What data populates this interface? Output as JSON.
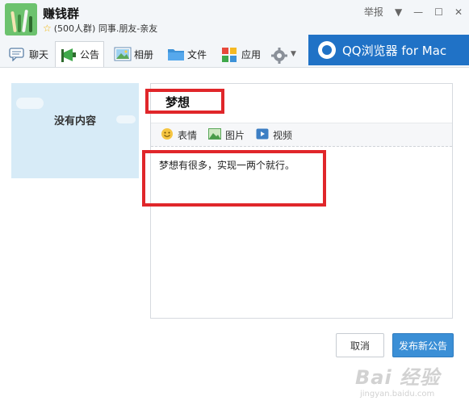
{
  "header": {
    "group_name": "赚钱群",
    "group_sub": "(500人群) 同事.朋友-亲友",
    "report_label": "举报"
  },
  "toolbar": {
    "tabs": [
      {
        "label": "聊天",
        "icon": "chat-icon"
      },
      {
        "label": "公告",
        "icon": "megaphone-icon",
        "active": true
      },
      {
        "label": "相册",
        "icon": "photo-icon"
      },
      {
        "label": "文件",
        "icon": "folder-icon"
      },
      {
        "label": "应用",
        "icon": "apps-icon"
      },
      {
        "label": "",
        "icon": "gear-icon"
      }
    ]
  },
  "ad": {
    "text": "QQ浏览器 for Mac"
  },
  "preview": {
    "empty_text": "没有内容"
  },
  "editor": {
    "title": "梦想",
    "insert_options": [
      {
        "label": "表情",
        "icon": "emoji-icon"
      },
      {
        "label": "图片",
        "icon": "image-icon"
      },
      {
        "label": "视频",
        "icon": "video-icon"
      }
    ],
    "content": "梦想有很多，实现一两个就行。"
  },
  "actions": {
    "cancel_label": "取消",
    "publish_label": "发布新公告"
  },
  "watermark": {
    "brand": "Bai 经验",
    "url": "jingyan.baidu.com"
  },
  "colors": {
    "accent": "#3b8fd6",
    "ad_background": "#2072c6",
    "highlight": "#e0262a"
  }
}
